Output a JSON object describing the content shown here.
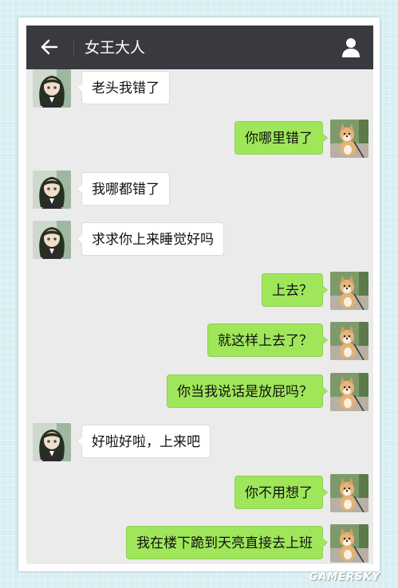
{
  "header": {
    "title": "女王大人",
    "back_icon": "arrow-left-icon",
    "profile_icon": "person-icon"
  },
  "colors": {
    "header_bg": "#393a3f",
    "chat_bg": "#ebebeb",
    "outgoing_bubble": "#9fe65b",
    "incoming_bubble": "#ffffff"
  },
  "messages": [
    {
      "side": "left",
      "text": "老头我错了",
      "avatar": "anime-girl-avatar"
    },
    {
      "side": "right",
      "text": "你哪里错了",
      "avatar": "shiba-dog-avatar"
    },
    {
      "side": "left",
      "text": "我哪都错了",
      "avatar": "anime-girl-avatar"
    },
    {
      "side": "left",
      "text": "求求你上来睡觉好吗",
      "avatar": "anime-girl-avatar"
    },
    {
      "side": "right",
      "text": "上去？",
      "avatar": "shiba-dog-avatar"
    },
    {
      "side": "right",
      "text": "就这样上去了？",
      "avatar": "shiba-dog-avatar"
    },
    {
      "side": "right",
      "text": "你当我说话是放屁吗？",
      "avatar": "shiba-dog-avatar"
    },
    {
      "side": "left",
      "text": "好啦好啦，上来吧",
      "avatar": "anime-girl-avatar"
    },
    {
      "side": "right",
      "text": "你不用想了",
      "avatar": "shiba-dog-avatar"
    },
    {
      "side": "right",
      "text": "我在楼下跪到天亮直接去上班",
      "avatar": "shiba-dog-avatar"
    }
  ],
  "watermark": "GAMERSKY"
}
